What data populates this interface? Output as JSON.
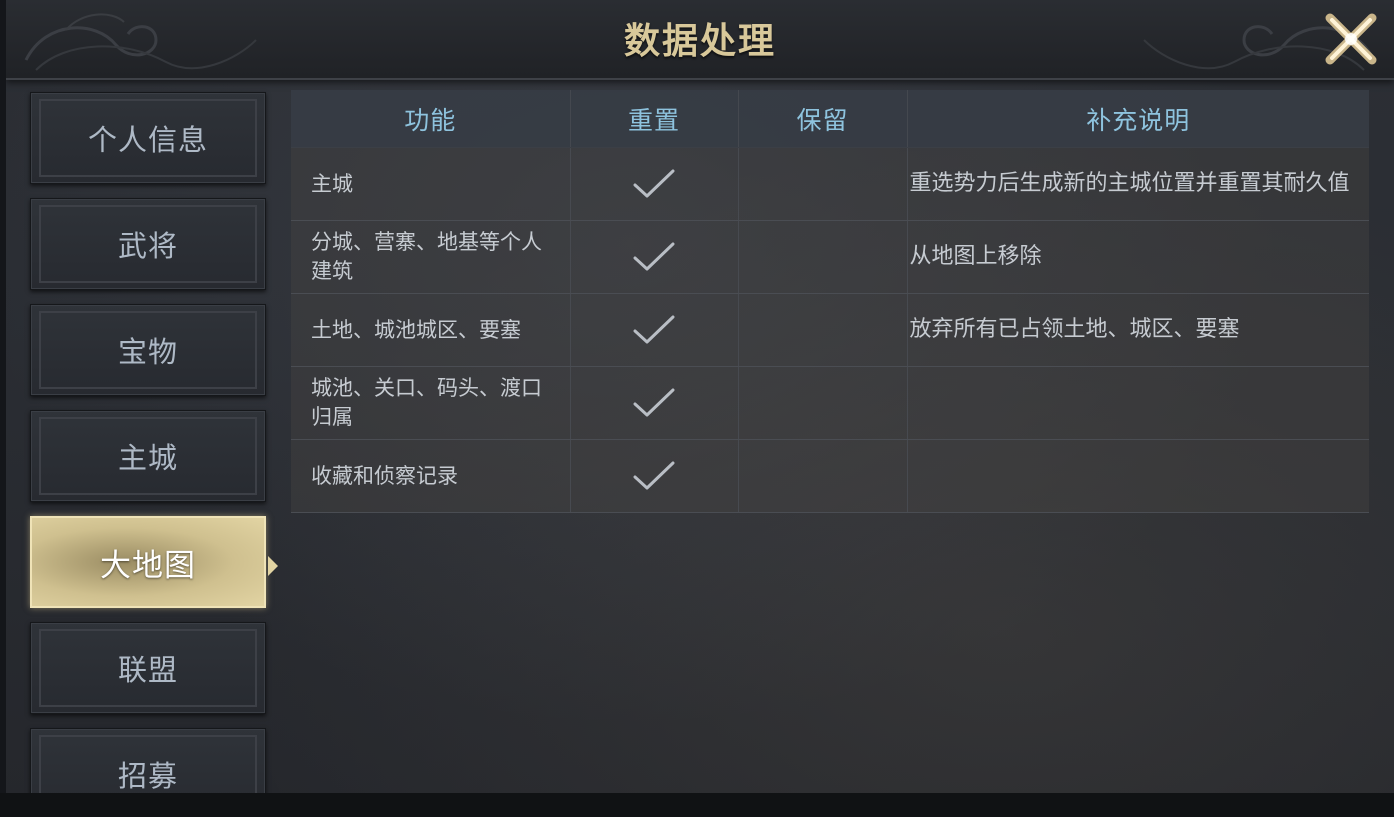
{
  "header": {
    "title": "数据处理"
  },
  "sidebar": {
    "items": [
      {
        "label": "个人信息"
      },
      {
        "label": "武将"
      },
      {
        "label": "宝物"
      },
      {
        "label": "主城"
      },
      {
        "label": "大地图"
      },
      {
        "label": "联盟"
      },
      {
        "label": "招募"
      }
    ],
    "active_index": 4
  },
  "table": {
    "headers": [
      "功能",
      "重置",
      "保留",
      "补充说明"
    ],
    "rows": [
      {
        "func": "主城",
        "reset": true,
        "keep": false,
        "note": "重选势力后生成新的主城位置并重置其耐久值"
      },
      {
        "func": "分城、营寨、地基等个人建筑",
        "reset": true,
        "keep": false,
        "note": "从地图上移除"
      },
      {
        "func": "土地、城池城区、要塞",
        "reset": true,
        "keep": false,
        "note": "放弃所有已占领土地、城区、要塞"
      },
      {
        "func": "城池、关口、码头、渡口归属",
        "reset": true,
        "keep": false,
        "note": ""
      },
      {
        "func": "收藏和侦察记录",
        "reset": true,
        "keep": false,
        "note": ""
      }
    ]
  },
  "icons": {
    "close": "close-icon",
    "check": "check-icon"
  },
  "colors": {
    "title": "#d8c89a",
    "header_text": "#8ec3de",
    "active_tab": "#e2d4a3"
  }
}
